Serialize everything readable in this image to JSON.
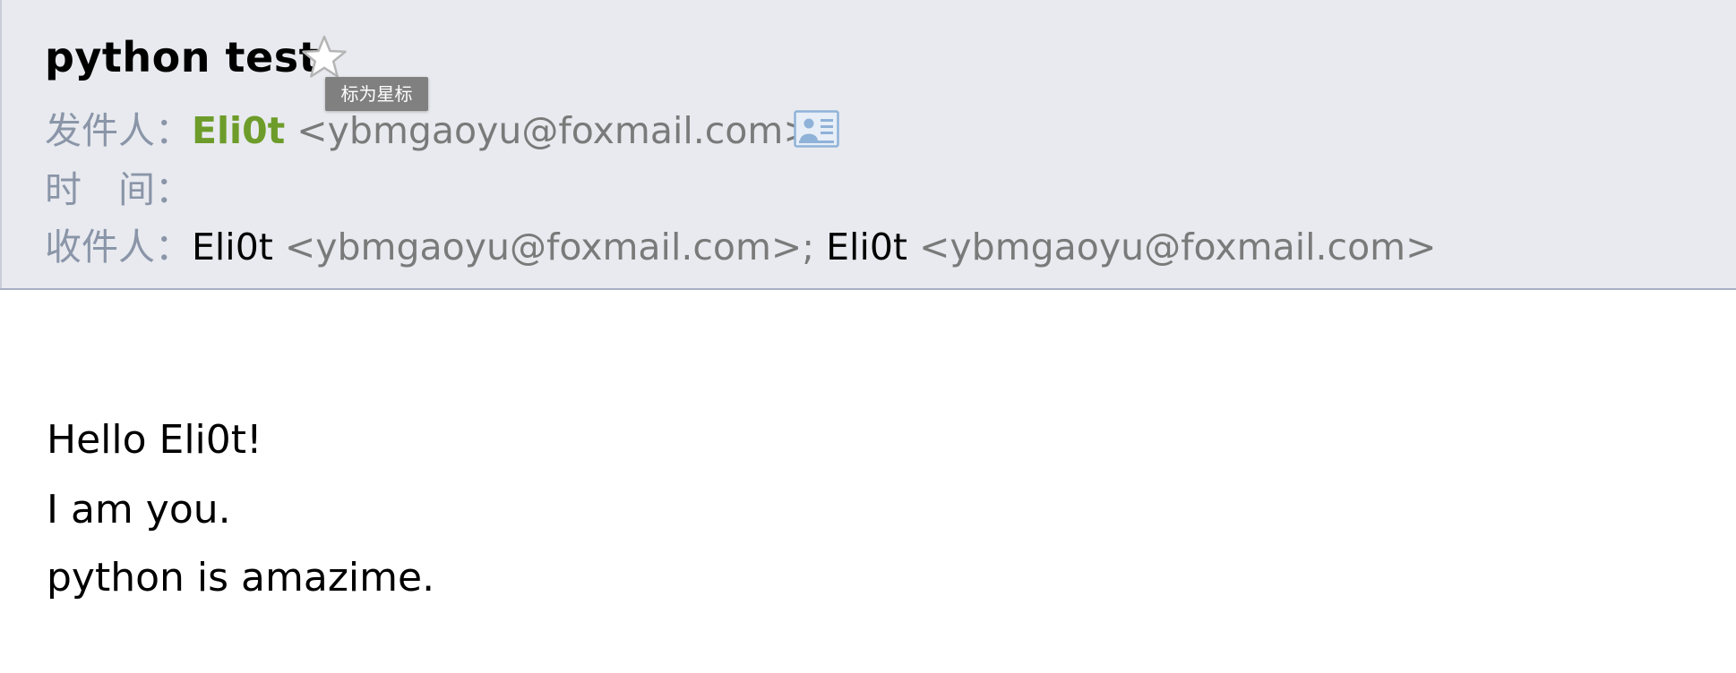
{
  "email": {
    "subject": "python test",
    "star_tooltip": "标为星标",
    "from": {
      "label": "发件人：",
      "name": "Eli0t",
      "address": "<ybmgaoyu@foxmail.com>"
    },
    "time": {
      "label": "时　间：",
      "value": ""
    },
    "to": {
      "label": "收件人：",
      "recipients": [
        {
          "name": "Eli0t",
          "address": "<ybmgaoyu@foxmail.com>",
          "sep": "; "
        },
        {
          "name": "Eli0t",
          "address": "<ybmgaoyu@foxmail.com>",
          "sep": ""
        }
      ]
    },
    "body_lines": [
      "Hello Eli0t!",
      "I am you.",
      "python is amazime."
    ]
  },
  "icons": {
    "star": "star-outline-icon",
    "contact": "contact-card-icon"
  },
  "colors": {
    "header_bg": "#e8eaef",
    "header_border": "#a7b0c4",
    "label": "#8a95a8",
    "sender_name": "#6d9c2a",
    "address": "#7a7a7a",
    "tooltip_bg": "#808080"
  }
}
